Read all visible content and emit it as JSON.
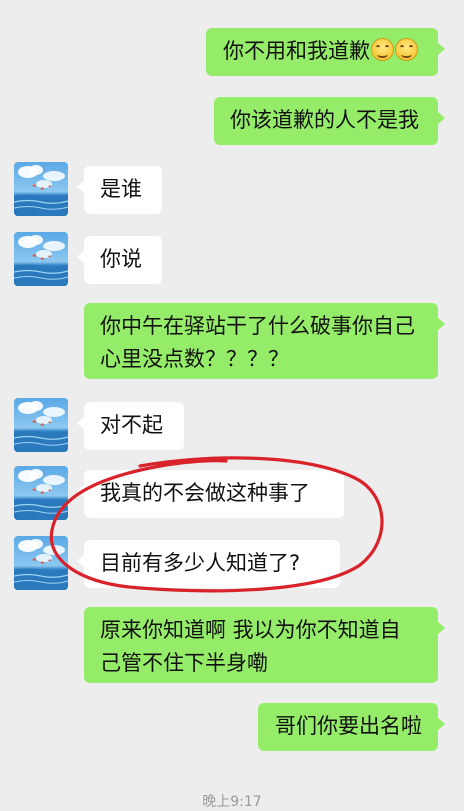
{
  "chat": {
    "messages": [
      {
        "sender": "me",
        "text": "你不用和我道歉",
        "emoji": [
          "smiling-face-emoji",
          "smiling-face-emoji"
        ]
      },
      {
        "sender": "me",
        "text": "你该道歉的人不是我"
      },
      {
        "sender": "them",
        "text": "是谁"
      },
      {
        "sender": "them",
        "text": "你说"
      },
      {
        "sender": "me",
        "lines": [
          "你中午在驿站干了什么破事你自己",
          "心里没点数？？？？"
        ]
      },
      {
        "sender": "them",
        "text": "对不起"
      },
      {
        "sender": "them",
        "text": "我真的不会做这种事了"
      },
      {
        "sender": "them",
        "text": "目前有多少人知道了?"
      },
      {
        "sender": "me",
        "lines": [
          "原来你知道啊 我以为你不知道自",
          "己管不住下半身嘞"
        ]
      },
      {
        "sender": "me",
        "text": "哥们你要出名啦"
      }
    ],
    "timestamp": "晚上9:17"
  },
  "colors": {
    "background": "#ededed",
    "my_bubble": "#95ec69",
    "their_bubble": "#ffffff",
    "annotation_circle": "#d8232a"
  },
  "icons": {
    "avatar": "sky-clouds-sea-avatar",
    "emoji": "smiling-face-emoji"
  }
}
